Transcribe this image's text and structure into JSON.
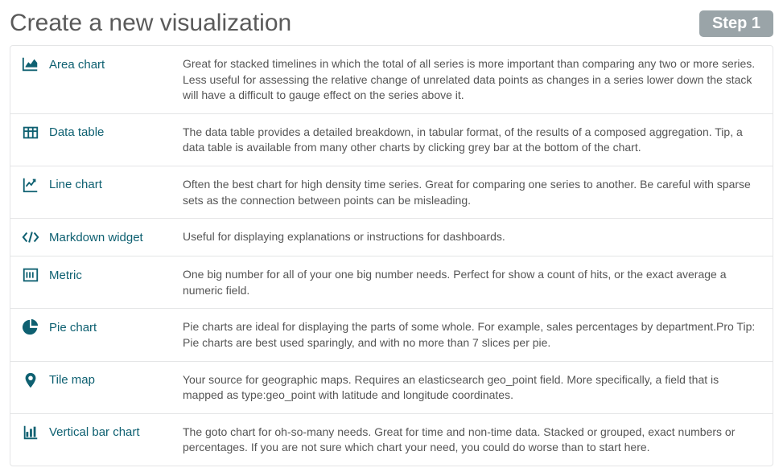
{
  "header": {
    "title": "Create a new visualization",
    "step_label": "Step 1"
  },
  "visualizations": [
    {
      "icon": "area-chart-icon",
      "label": "Area chart",
      "description": "Great for stacked timelines in which the total of all series is more important than comparing any two or more series. Less useful for assessing the relative change of unrelated data points as changes in a series lower down the stack will have a difficult to gauge effect on the series above it."
    },
    {
      "icon": "data-table-icon",
      "label": "Data table",
      "description": "The data table provides a detailed breakdown, in tabular format, of the results of a composed aggregation. Tip, a data table is available from many other charts by clicking grey bar at the bottom of the chart."
    },
    {
      "icon": "line-chart-icon",
      "label": "Line chart",
      "description": "Often the best chart for high density time series. Great for comparing one series to another. Be careful with sparse sets as the connection between points can be misleading."
    },
    {
      "icon": "markdown-icon",
      "label": "Markdown widget",
      "description": "Useful for displaying explanations or instructions for dashboards."
    },
    {
      "icon": "metric-icon",
      "label": "Metric",
      "description": "One big number for all of your one big number needs. Perfect for show a count of hits, or the exact average a numeric field."
    },
    {
      "icon": "pie-chart-icon",
      "label": "Pie chart",
      "description": "Pie charts are ideal for displaying the parts of some whole. For example, sales percentages by department.Pro Tip: Pie charts are best used sparingly, and with no more than 7 slices per pie."
    },
    {
      "icon": "tile-map-icon",
      "label": "Tile map",
      "description": "Your source for geographic maps. Requires an elasticsearch geo_point field. More specifically, a field that is mapped as type:geo_point with latitude and longitude coordinates."
    },
    {
      "icon": "vertical-bar-icon",
      "label": "Vertical bar chart",
      "description": "The goto chart for oh-so-many needs. Great for time and non-time data. Stacked or grouped, exact numbers or percentages. If you are not sure which chart your need, you could do worse than to start here."
    }
  ]
}
